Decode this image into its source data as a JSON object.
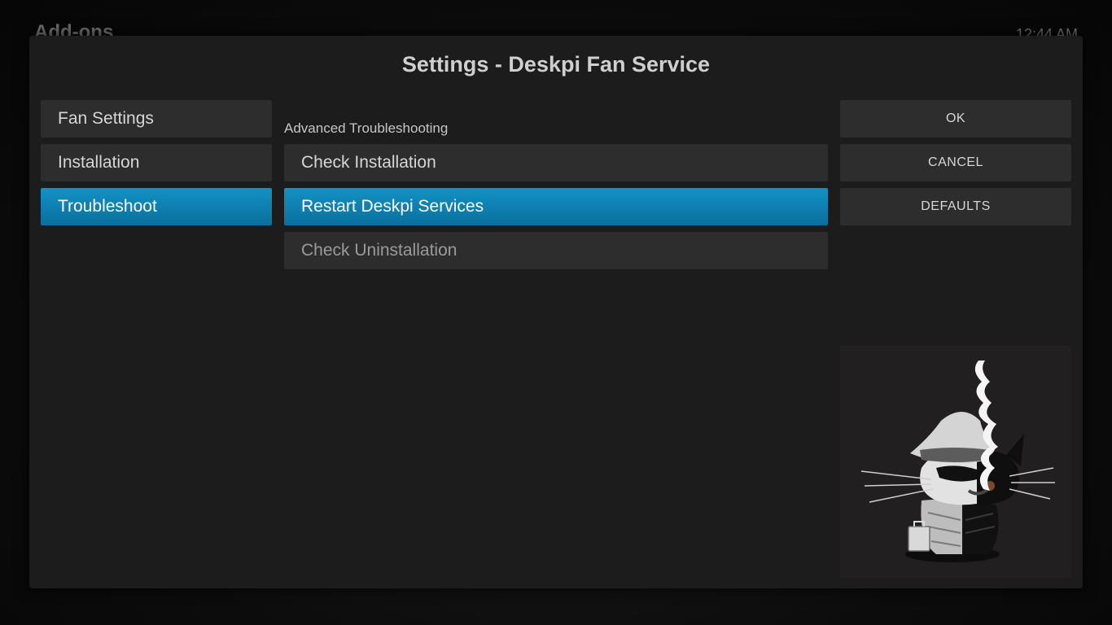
{
  "background": {
    "title": "Add-ons",
    "clock": "12:44 AM"
  },
  "dialog": {
    "title": "Settings - Deskpi Fan Service",
    "categories": [
      {
        "label": "Fan Settings",
        "selected": false
      },
      {
        "label": "Installation",
        "selected": false
      },
      {
        "label": "Troubleshoot",
        "selected": true
      }
    ],
    "group_label": "Advanced Troubleshooting",
    "settings": [
      {
        "label": "Check Installation",
        "focused": false,
        "enabled": true
      },
      {
        "label": "Restart Deskpi Services",
        "focused": true,
        "enabled": true
      },
      {
        "label": "Check Uninstallation",
        "focused": false,
        "enabled": false
      }
    ],
    "actions": {
      "ok": "OK",
      "cancel": "CANCEL",
      "defaults": "DEFAULTS"
    },
    "addon_icon": "cat-detective-icon"
  },
  "colors": {
    "focus_accent": "#1391c4",
    "button_bg": "#2d2d2d",
    "dialog_bg": "#1c1c1c"
  }
}
